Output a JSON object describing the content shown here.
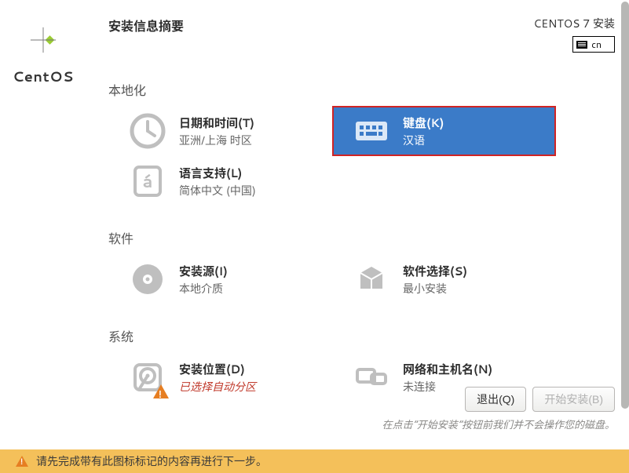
{
  "brand": "CentOS",
  "header": {
    "title": "安装信息摘要",
    "product": "CENTOS 7 安装",
    "keyboard_indicator": "cn"
  },
  "categories": [
    {
      "title": "本地化",
      "spokes": [
        {
          "icon": "clock",
          "title": "日期和时间(T)",
          "sub": "亚洲/上海 时区",
          "warn": false,
          "selected": false
        },
        {
          "icon": "keyboard",
          "title": "键盘(K)",
          "sub": "汉语",
          "warn": false,
          "selected": true
        },
        {
          "icon": "lang",
          "title": "语言支持(L)",
          "sub": "简体中文 (中国)",
          "warn": false,
          "selected": false
        }
      ]
    },
    {
      "title": "软件",
      "spokes": [
        {
          "icon": "disc",
          "title": "安装源(I)",
          "sub": "本地介质",
          "warn": false,
          "selected": false
        },
        {
          "icon": "pkg",
          "title": "软件选择(S)",
          "sub": "最小安装",
          "warn": false,
          "selected": false
        }
      ]
    },
    {
      "title": "系统",
      "spokes": [
        {
          "icon": "hdd",
          "title": "安装位置(D)",
          "sub": "已选择自动分区",
          "warn": true,
          "selected": false
        },
        {
          "icon": "net",
          "title": "网络和主机名(N)",
          "sub": "未连接",
          "warn": false,
          "selected": false
        }
      ]
    }
  ],
  "footer": {
    "quit": "退出(Q)",
    "begin": "开始安装(B)",
    "hint": "在点击“开始安装”按钮前我们并不会操作您的磁盘。"
  },
  "warnbar": "请先完成带有此图标标记的内容再进行下一步。"
}
